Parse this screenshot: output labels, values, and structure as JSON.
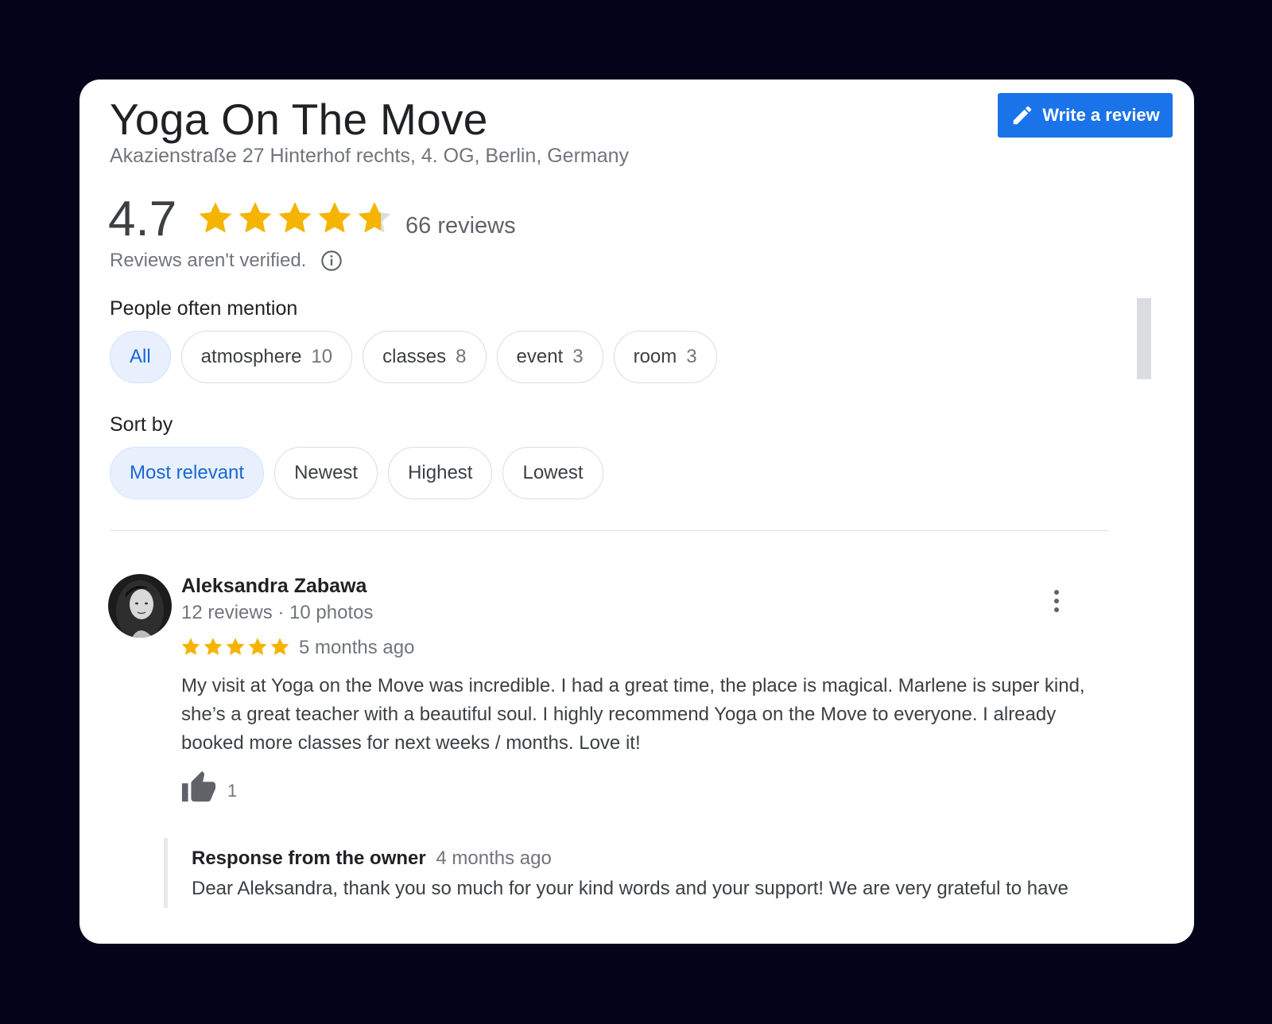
{
  "place": {
    "name": "Yoga On The Move",
    "address": "Akazienstraße 27 Hinterhof rechts, 4. OG, Berlin, Germany"
  },
  "write_review": {
    "label": "Write a review",
    "icon": "pencil-icon"
  },
  "rating": {
    "value": "4.7",
    "stars": 4.7,
    "reviews_label": "66 reviews",
    "unverified_text": "Reviews aren't verified.",
    "info_icon": "info-icon"
  },
  "mentions": {
    "label": "People often mention",
    "chips": [
      {
        "label": "All",
        "count": "",
        "selected": true
      },
      {
        "label": "atmosphere",
        "count": "10",
        "selected": false
      },
      {
        "label": "classes",
        "count": "8",
        "selected": false
      },
      {
        "label": "event",
        "count": "3",
        "selected": false
      },
      {
        "label": "room",
        "count": "3",
        "selected": false
      }
    ]
  },
  "sort": {
    "label": "Sort by",
    "options": [
      "Most relevant",
      "Newest",
      "Highest",
      "Lowest"
    ],
    "selected": "Most relevant"
  },
  "colors": {
    "star": "#f4b400",
    "star_empty": "#dadce0",
    "accent": "#1a73e8",
    "chip_selected_bg": "#e8f0fe",
    "chip_selected_text": "#1967d2"
  },
  "review": {
    "author": "Aleksandra Zabawa",
    "meta": "12 reviews · 10 photos",
    "stars": 5,
    "time": "5 months ago",
    "text": "My visit at Yoga on the Move was incredible. I had a great time, the place is magical. Marlene is super kind, she’s a great teacher with a beautiful soul. I highly recommend Yoga on the Move to everyone. I already booked more classes for next weeks / months. Love it!",
    "likes": "1",
    "response": {
      "label": "Response from the owner",
      "time": "4 months ago",
      "text": "Dear Aleksandra, thank you so much for your kind words and your support! We are very grateful to have"
    }
  }
}
